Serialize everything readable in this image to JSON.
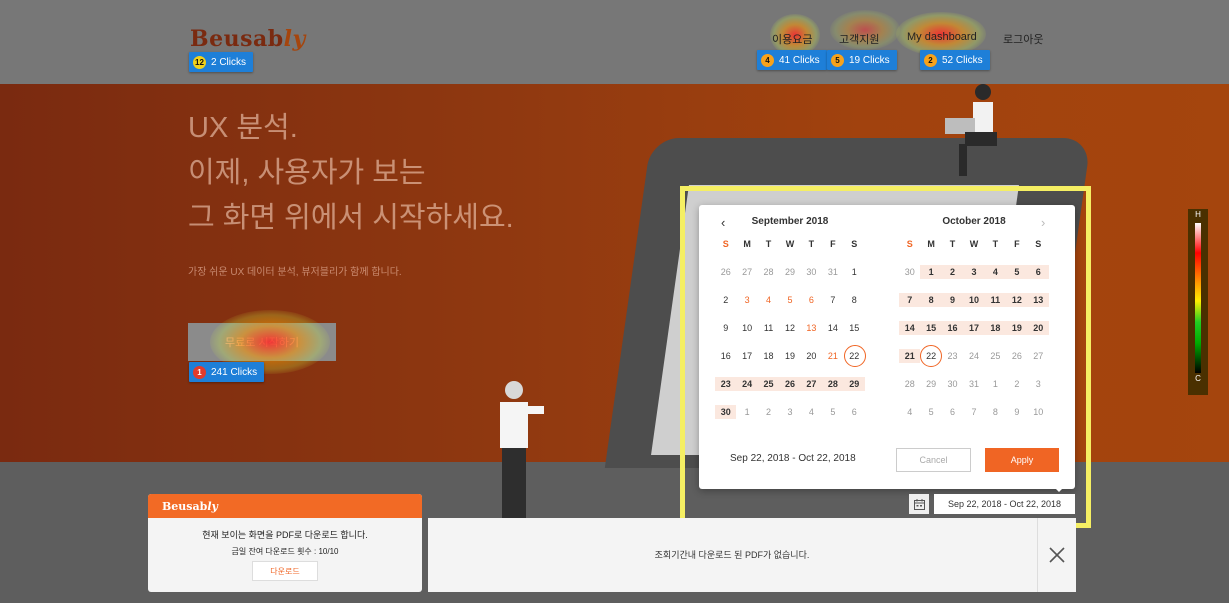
{
  "header": {
    "logo": "Beusab",
    "logo_suffix": "ly",
    "logo_badge": {
      "rank": "12",
      "clicks": "2 Clicks"
    },
    "nav": [
      {
        "label": "이용요금",
        "rank": "4",
        "clicks": "41 Clicks"
      },
      {
        "label": "고객지원",
        "rank": "5",
        "clicks": "19 Clicks"
      },
      {
        "label": "My dashboard",
        "rank": "2",
        "clicks": "52 Clicks"
      },
      {
        "label": "로그아웃"
      }
    ]
  },
  "hero": {
    "title_lines": [
      "UX 분석.",
      "이제, 사용자가 보는",
      "그 화면 위에서 시작하세요."
    ],
    "subtitle": "가장 쉬운 UX 데이터 분석, 뷰저블리가 함께 합니다.",
    "cta_label": "무료로 시작하기",
    "cta_badge": {
      "rank": "1",
      "clicks": "241 Clicks"
    }
  },
  "calendar": {
    "left_month": "September 2018",
    "right_month": "October 2018",
    "weekdays": [
      "S",
      "M",
      "T",
      "W",
      "T",
      "F",
      "S"
    ],
    "range_text": "Sep 22, 2018 - Oct 22, 2018",
    "cancel_label": "Cancel",
    "apply_label": "Apply",
    "sep_weeks": [
      [
        "26",
        "27",
        "28",
        "29",
        "30",
        "31",
        "1"
      ],
      [
        "2",
        "3",
        "4",
        "5",
        "6",
        "7",
        "8"
      ],
      [
        "9",
        "10",
        "11",
        "12",
        "13",
        "14",
        "15"
      ],
      [
        "16",
        "17",
        "18",
        "19",
        "20",
        "21",
        "22"
      ],
      [
        "23",
        "24",
        "25",
        "26",
        "27",
        "28",
        "29"
      ],
      [
        "30",
        "1",
        "2",
        "3",
        "4",
        "5",
        "6"
      ]
    ],
    "oct_weeks": [
      [
        "30",
        "1",
        "2",
        "3",
        "4",
        "5",
        "6"
      ],
      [
        "7",
        "8",
        "9",
        "10",
        "11",
        "12",
        "13"
      ],
      [
        "14",
        "15",
        "16",
        "17",
        "18",
        "19",
        "20"
      ],
      [
        "21",
        "22",
        "23",
        "24",
        "25",
        "26",
        "27"
      ],
      [
        "28",
        "29",
        "30",
        "31",
        "1",
        "2",
        "3"
      ],
      [
        "4",
        "5",
        "6",
        "7",
        "8",
        "9",
        "10"
      ]
    ]
  },
  "date_field": "Sep 22, 2018 - Oct 22, 2018",
  "legend": {
    "high": "H",
    "low": "C"
  },
  "pdf_panel": {
    "logo": "Beusab",
    "logo_suffix": "ly",
    "line1": "현재 보이는 화면을 PDF로 다운로드 합니다.",
    "line2": "금일 잔여 다운로드 횟수 : 10/10",
    "download_label": "다운로드"
  },
  "history_panel": {
    "message": "조회기간내 다운로드 된 PDF가 없습니다."
  },
  "colors": {
    "accent": "#f06524",
    "badge_blue": "#1e7fd8",
    "highlight": "#f5ef63"
  }
}
